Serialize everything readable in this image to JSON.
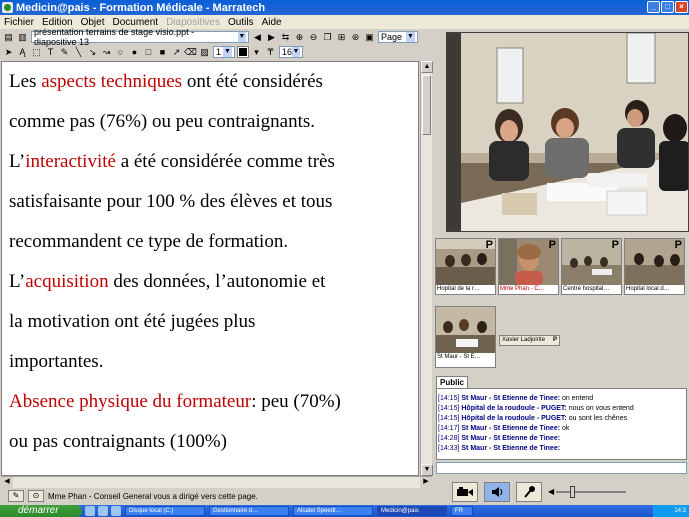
{
  "window": {
    "title": "Medicin@pais - Formation Médicale - Marratech",
    "buttons": [
      "_",
      "□",
      "×"
    ]
  },
  "menu": [
    "Fichier",
    "Edition",
    "Objet",
    "Document",
    "Diapositives",
    "Outils",
    "Aide"
  ],
  "menu_disabled": [
    "Diapositives"
  ],
  "toolbar": {
    "document_select": "présentation terrains de stage visio.ppt - diapositive 13",
    "view_select": "Page",
    "line_width": "1",
    "font_size": "16"
  },
  "slide": {
    "lines": [
      {
        "parts": [
          {
            "text": "Les ",
            "red": false
          },
          {
            "text": "aspects techniques",
            "red": true
          },
          {
            "text": " ont été considérés",
            "red": false
          }
        ]
      },
      {
        "parts": [
          {
            "text": "comme pas (76%) ou peu contraignants.",
            "red": false
          }
        ]
      },
      {
        "parts": [
          {
            "text": "L’",
            "red": false
          },
          {
            "text": "interactivité",
            "red": true
          },
          {
            "text": " a été considérée comme très",
            "red": false
          }
        ]
      },
      {
        "parts": [
          {
            "text": "satisfaisante pour 100 % des élèves et tous",
            "red": false
          }
        ]
      },
      {
        "parts": [
          {
            "text": "recommandent ce type de formation.",
            "red": false
          }
        ]
      },
      {
        "parts": [
          {
            "text": "L’",
            "red": false
          },
          {
            "text": "acquisition",
            "red": true
          },
          {
            "text": " des données, l’autonomie et",
            "red": false
          }
        ]
      },
      {
        "parts": [
          {
            "text": "la motivation ont été jugées plus",
            "red": false
          }
        ]
      },
      {
        "parts": [
          {
            "text": "importantes.",
            "red": false
          }
        ]
      },
      {
        "parts": [
          {
            "text": "Absence physique du formateur",
            "red": true
          },
          {
            "text": ": peu (70%)",
            "red": false
          }
        ]
      },
      {
        "parts": [
          {
            "text": "ou pas contraignants (100%)",
            "red": false
          }
        ]
      }
    ]
  },
  "statusbar": {
    "message": "Mme Phan - Conseil General vous a dirigé vers cette page."
  },
  "participants": [
    {
      "label": "Hopital de la r…",
      "highlight": false,
      "flag": "P"
    },
    {
      "label": "Mme Phan - C…",
      "highlight": true,
      "flag": "P"
    },
    {
      "label": "Centre hospital…",
      "highlight": false,
      "flag": "P"
    },
    {
      "label": "Hopital local d…",
      "highlight": false,
      "flag": "P"
    },
    {
      "label": "St Maur - St E…",
      "highlight": false,
      "flag": ""
    }
  ],
  "participant_name_only": {
    "label": "Xavier Ladjointe",
    "flag": "P"
  },
  "chat": {
    "tab": "Public",
    "messages": [
      {
        "time": "[14:15]",
        "who": "St Maur - St Etienne de Tinee:",
        "text": " on entend"
      },
      {
        "time": "[14:15]",
        "who": "Hôpital de la roudoule - PUGET:",
        "text": " nous on vous entend"
      },
      {
        "time": "[14:15]",
        "who": "Hôpital de la roudoule - PUGET:",
        "text": " ou sont les chênes"
      },
      {
        "time": "[14:17]",
        "who": "St Maur - St Etienne de Tinee:",
        "text": " ok"
      },
      {
        "time": "[14:28]",
        "who": "St Maur - St Etienne de Tinee:",
        "text": ""
      },
      {
        "time": "[14:33]",
        "who": "St Maur - St Etienne de Tinee:",
        "text": ""
      }
    ]
  },
  "taskbar": {
    "start": "démarrer",
    "items": [
      {
        "label": "Disque local (C:)",
        "active": false
      },
      {
        "label": "Gestionnaire d…",
        "active": false
      },
      {
        "label": "Alcatel Speedt…",
        "active": false
      },
      {
        "label": "Medicin@pais",
        "active": true
      },
      {
        "label": "FR",
        "active": false
      }
    ],
    "clock": "14:3"
  },
  "colors": {
    "title_blue": "#2466d6",
    "accent_red": "#c00000",
    "chat_blue": "#00007f",
    "taskbar_blue": "#245edb",
    "start_green": "#2b8a2a"
  }
}
